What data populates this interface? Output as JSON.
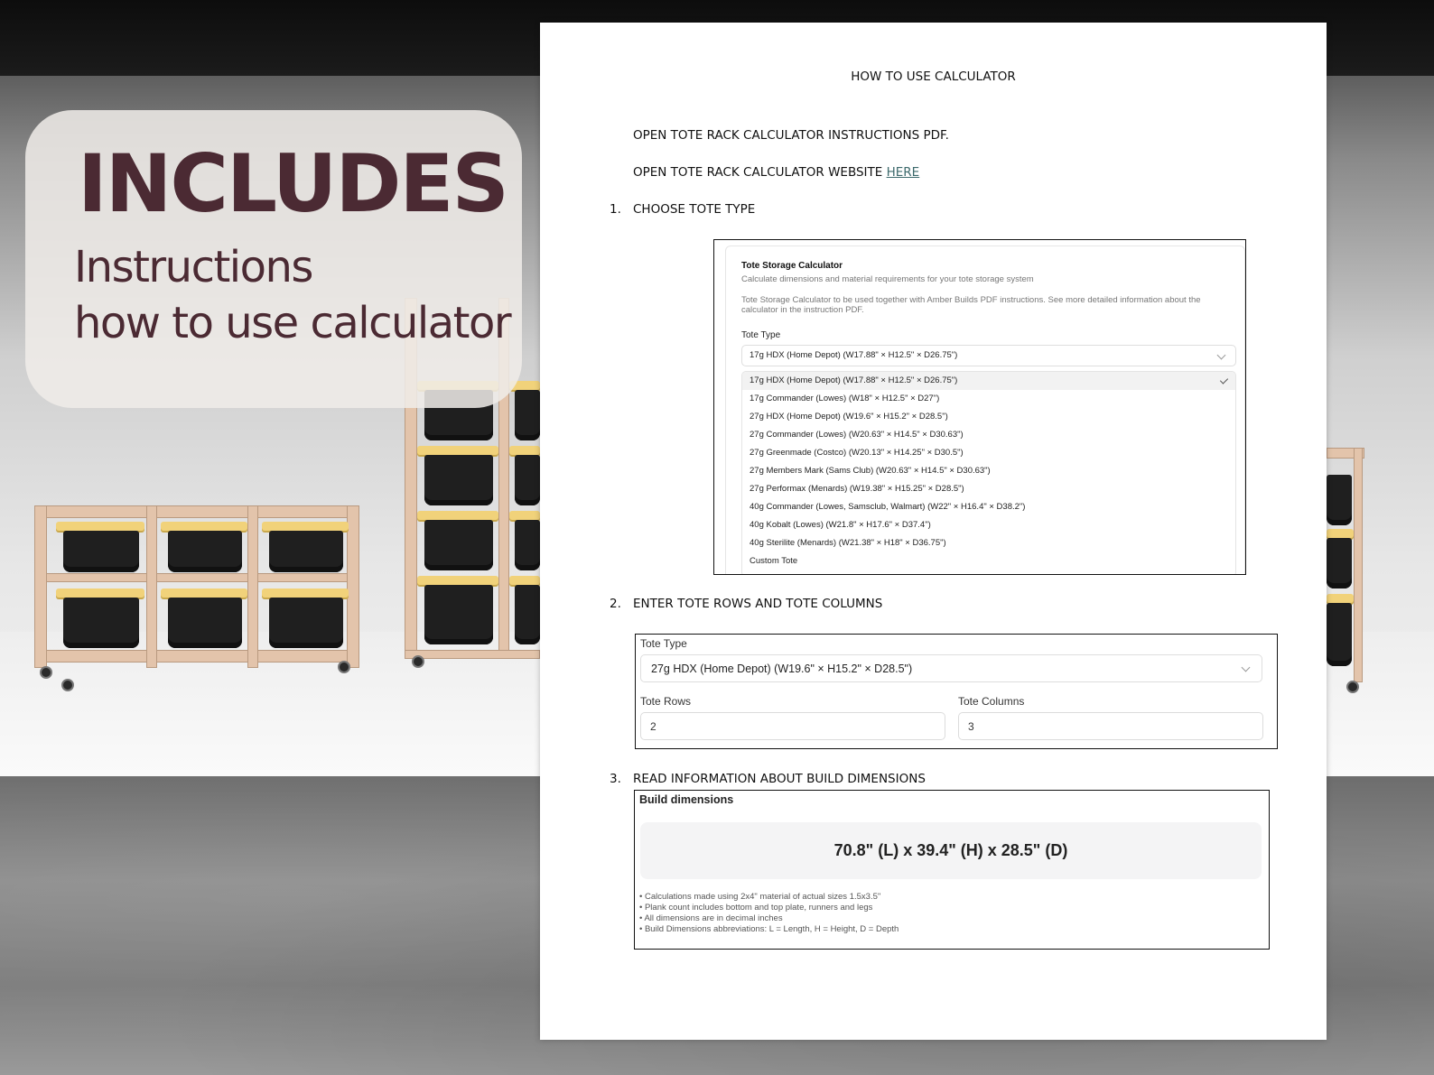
{
  "promo": {
    "heading": "INCLUDES",
    "sub_line1": "Instructions",
    "sub_line2": "how to use calculator"
  },
  "doc": {
    "title": "HOW TO USE CALCULATOR",
    "line_pdf": "OPEN TOTE RACK CALCULATOR INSTRUCTIONS PDF.",
    "line_website_prefix": "OPEN TOTE RACK CALCULATOR WEBSITE ",
    "line_website_link": "HERE",
    "steps": [
      {
        "number": "1.",
        "label": "CHOOSE TOTE TYPE"
      },
      {
        "number": "2.",
        "label": "ENTER TOTE ROWS AND TOTE COLUMNS"
      },
      {
        "number": "3.",
        "label": "READ INFORMATION ABOUT BUILD DIMENSIONS"
      }
    ]
  },
  "calc1": {
    "app_title": "Tote Storage Calculator",
    "app_subtitle": "Calculate dimensions and material requirements for your tote storage system",
    "description_line1": "Tote Storage Calculator to be used together with Amber Builds PDF instructions. See more detailed information about the",
    "description_line2": "calculator in the instruction PDF.",
    "tote_type_label": "Tote Type",
    "selected_value": "17g HDX (Home Depot)  (W17.88\" × H12.5\" × D26.75\")",
    "options": [
      "17g HDX (Home Depot)  (W17.88\" × H12.5\" × D26.75\")",
      "17g Commander (Lowes)  (W18\" × H12.5\" × D27\")",
      "27g HDX (Home Depot)  (W19.6\" × H15.2\" × D28.5\")",
      "27g Commander (Lowes)  (W20.63\" × H14.5\" × D30.63\")",
      "27g Greenmade (Costco)  (W20.13\" × H14.25\" × D30.5\")",
      "27g Members Mark (Sams Club)  (W20.63\" × H14.5\" × D30.63\")",
      "27g Performax (Menards)  (W19.38\" × H15.25\" × D28.5\")",
      "40g Commander (Lowes, Samsclub, Walmart)  (W22\" × H16.4\" × D38.2\")",
      "40g Kobalt (Lowes)  (W21.8\" × H17.6\" × D37.4\")",
      "40g Sterilite (Menards)  (W21.38\" × H18\" × D36.75\")",
      "Custom Tote"
    ]
  },
  "calc2": {
    "tote_type_label": "Tote Type",
    "tote_type_value": "27g HDX (Home Depot)  (W19.6\" × H15.2\" × D28.5\")",
    "rows_label": "Tote Rows",
    "rows_value": "2",
    "cols_label": "Tote Columns",
    "cols_value": "3"
  },
  "calc3": {
    "heading": "Build dimensions",
    "dimensions": "70.8\" (L) x 39.4\" (H) x 28.5\" (D)",
    "notes": [
      "• Calculations made using 2x4\" material of actual sizes 1.5x3.5\"",
      "• Plank count includes bottom and top plate, runners and legs",
      "• All dimensions are in decimal inches",
      "• Build Dimensions abbreviations: L = Length, H = Height, D = Depth"
    ]
  },
  "colors": {
    "promo_text": "#4b2a33",
    "link": "#3d6a6c",
    "tote_lid": "#f1d27a",
    "wood": "#e3c4ab"
  }
}
